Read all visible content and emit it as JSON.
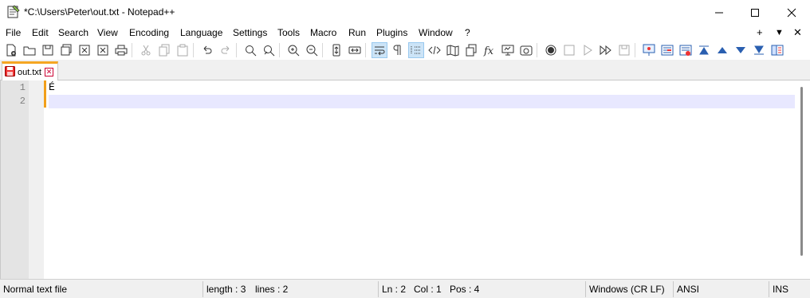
{
  "window": {
    "title": "*C:\\Users\\Peter\\out.txt - Notepad++",
    "min_label": "—",
    "max_label": "☐",
    "close_label": "✕"
  },
  "menu": {
    "items": [
      "File",
      "Edit",
      "Search",
      "View",
      "Encoding",
      "Language",
      "Settings",
      "Tools",
      "Macro",
      "Run",
      "Plugins",
      "Window",
      "?"
    ],
    "right": [
      "+",
      "▼",
      "✕"
    ]
  },
  "toolbar": {
    "icons": [
      "new-file-icon",
      "open-file-icon",
      "save-icon",
      "save-all-icon",
      "close-icon",
      "close-all-icon",
      "print-icon",
      "cut-icon",
      "copy-icon",
      "paste-icon",
      "undo-icon",
      "redo-icon",
      "find-icon",
      "replace-icon",
      "zoom-in-icon",
      "zoom-out-icon",
      "sync-vertical-icon",
      "sync-horizontal-icon",
      "word-wrap-icon",
      "show-all-chars-icon",
      "indent-guide-icon",
      "xml-tag-icon",
      "document-map-icon",
      "document-list-icon",
      "function-list-icon",
      "monitoring-icon",
      "panel-icon",
      "record-macro-icon",
      "stop-record-icon",
      "play-macro-icon",
      "run-macro-multiple-icon",
      "save-macro-icon",
      "spell-check-icon",
      "compare-icon",
      "compare-clear-icon",
      "first-diff-icon",
      "prev-diff-icon",
      "next-diff-icon",
      "last-diff-icon",
      "nav-bar-icon"
    ]
  },
  "tabs": [
    {
      "label": "out.txt",
      "close": "✕"
    }
  ],
  "editor": {
    "lines": [
      {
        "num": "1",
        "text": "É"
      },
      {
        "num": "2",
        "text": ""
      }
    ]
  },
  "status": {
    "file_type": "Normal text file",
    "length": "length : 3",
    "lines": "lines : 2",
    "ln": "Ln : 2",
    "col": "Col : 1",
    "pos": "Pos : 4",
    "eol": "Windows (CR LF)",
    "encoding": "ANSI",
    "mode": "INS"
  },
  "colors": {
    "accent": "#f29f1a",
    "current_line": "#e8e8ff",
    "active_button": "#cce4f7"
  }
}
